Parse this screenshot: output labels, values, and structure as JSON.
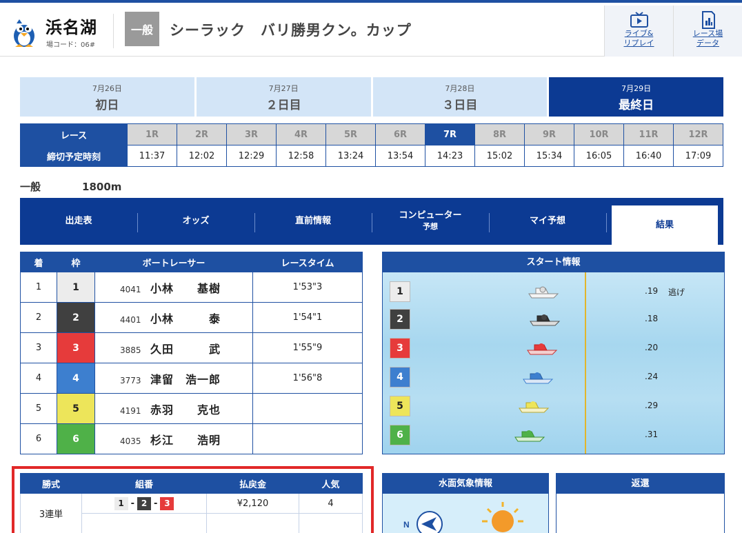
{
  "header": {
    "venue": "浜名湖",
    "venue_code": "場コード：06#",
    "grade": "一般",
    "race_title": "シーラック　バリ勝男クン。カップ",
    "live_label_1": "ライブ&",
    "live_label_2": "リプレイ",
    "data_label_1": "レース場",
    "data_label_2": "データ"
  },
  "days": [
    {
      "date": "7月26日",
      "label": "初日"
    },
    {
      "date": "7月27日",
      "label": "２日目"
    },
    {
      "date": "7月28日",
      "label": "３日目"
    },
    {
      "date": "7月29日",
      "label": "最終日"
    }
  ],
  "schedule": {
    "race_header": "レース",
    "time_header": "締切予定時刻",
    "races": [
      "1R",
      "2R",
      "3R",
      "4R",
      "5R",
      "6R",
      "7R",
      "8R",
      "9R",
      "10R",
      "11R",
      "12R"
    ],
    "times": [
      "11:37",
      "12:02",
      "12:29",
      "12:58",
      "13:24",
      "13:54",
      "14:23",
      "15:02",
      "15:34",
      "16:05",
      "16:40",
      "17:09"
    ],
    "current_index": 6
  },
  "race_info": {
    "class": "一般",
    "distance": "1800m"
  },
  "tabs": [
    "出走表",
    "オッズ",
    "直前情報",
    "コンピューター",
    "マイ予想",
    "結果"
  ],
  "tab_sub": "予想",
  "results": {
    "headers": [
      "着",
      "枠",
      "ボートレーサー",
      "レースタイム"
    ],
    "rows": [
      {
        "rank": "1",
        "waku": "1",
        "reg": "4041",
        "name": "小林　　基樹",
        "time": "1'53\"3"
      },
      {
        "rank": "2",
        "waku": "2",
        "reg": "4401",
        "name": "小林　　　泰",
        "time": "1'54\"1"
      },
      {
        "rank": "3",
        "waku": "3",
        "reg": "3885",
        "name": "久田　　　武",
        "time": "1'55\"9"
      },
      {
        "rank": "4",
        "waku": "4",
        "reg": "3773",
        "name": "津留　浩一郎",
        "time": "1'56\"8"
      },
      {
        "rank": "5",
        "waku": "5",
        "reg": "4191",
        "name": "赤羽　　克也",
        "time": ""
      },
      {
        "rank": "6",
        "waku": "6",
        "reg": "4035",
        "name": "杉江　　浩明",
        "time": ""
      }
    ]
  },
  "start_info": {
    "title": "スタート情報",
    "rows": [
      {
        "boat": "1",
        "st": ".19",
        "tech": "逃げ"
      },
      {
        "boat": "2",
        "st": ".18",
        "tech": ""
      },
      {
        "boat": "3",
        "st": ".20",
        "tech": ""
      },
      {
        "boat": "4",
        "st": ".24",
        "tech": ""
      },
      {
        "boat": "5",
        "st": ".29",
        "tech": ""
      },
      {
        "boat": "6",
        "st": ".31",
        "tech": ""
      }
    ]
  },
  "payout": {
    "headers": [
      "勝式",
      "組番",
      "払戻金",
      "人気"
    ],
    "type": "3連単",
    "combo": [
      "1",
      "2",
      "3"
    ],
    "amount": "¥2,120",
    "popularity": "4"
  },
  "weather": {
    "title": "水面気象情報",
    "wind_dir_label": "N"
  },
  "return_panel": {
    "title": "返還"
  },
  "colors": {
    "primary": "#1e50a2",
    "dark": "#0c3a93",
    "highlight": "#e12828"
  }
}
